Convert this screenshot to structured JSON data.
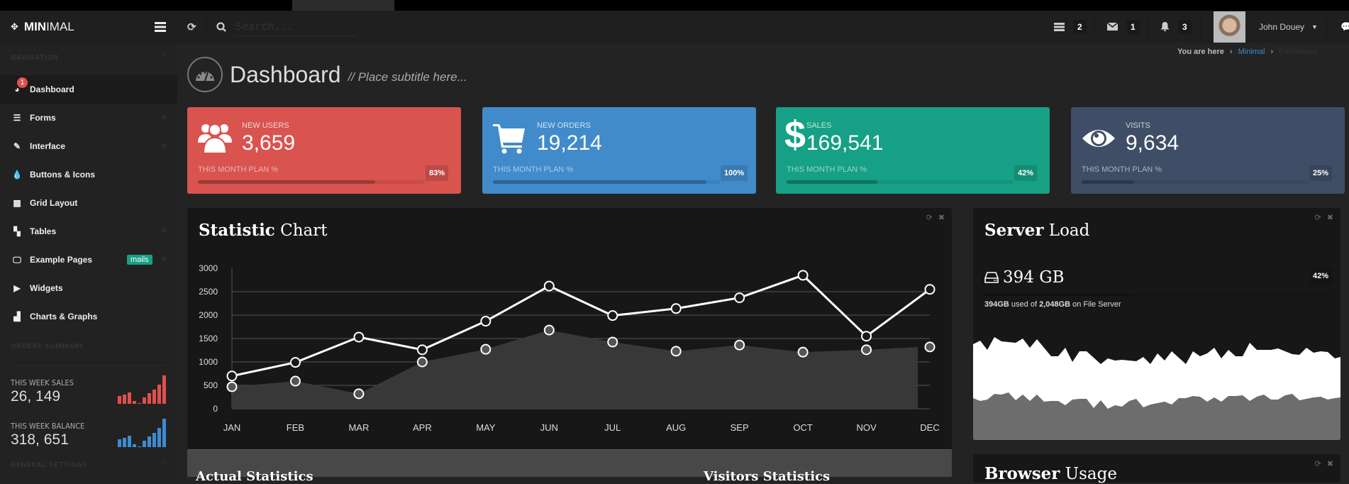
{
  "brand": {
    "bold": "MIN",
    "rest": "IMAL"
  },
  "header": {
    "search_placeholder": "Search...",
    "notifications": [
      {
        "icon": "tasks-icon",
        "count": "2"
      },
      {
        "icon": "envelope-icon",
        "count": "1"
      },
      {
        "icon": "bell-icon",
        "count": "3"
      }
    ],
    "user_name": "John Douey"
  },
  "breadcrumb": {
    "prefix": "You are here",
    "items": [
      "Minimal",
      "Dashboard"
    ]
  },
  "page": {
    "title": "Dashboard",
    "subtitle": "// Place subtitle here..."
  },
  "sidebar": {
    "navigation_title": "NAVIGATION",
    "items": [
      {
        "label": "Dashboard",
        "icon": "dashboard-icon",
        "badge": "1",
        "active": true
      },
      {
        "label": "Forms",
        "icon": "list-icon",
        "expandable": true
      },
      {
        "label": "Interface",
        "icon": "pencil-icon",
        "expandable": true
      },
      {
        "label": "Buttons & Icons",
        "icon": "tint-icon"
      },
      {
        "label": "Grid Layout",
        "icon": "grid-icon"
      },
      {
        "label": "Tables",
        "icon": "table-icon",
        "expandable": true
      },
      {
        "label": "Example Pages",
        "icon": "desktop-icon",
        "tag": "mails",
        "expandable": true
      },
      {
        "label": "Widgets",
        "icon": "play-circle-icon"
      },
      {
        "label": "Charts & Graphs",
        "icon": "bar-chart-icon"
      }
    ],
    "orders_title": "ORDERS SUMMARY",
    "week_sales": {
      "label": "THIS WEEK SALES",
      "value": "26, 149",
      "color": "#e0504d",
      "bars": [
        4,
        5,
        6,
        1.5,
        0.5,
        3.5,
        5.5,
        7.5,
        10,
        15
      ]
    },
    "week_balance": {
      "label": "THIS WEEK BALANCE",
      "value": "318, 651",
      "color": "#3d8bd2",
      "bars": [
        4,
        5,
        6,
        1.5,
        0.5,
        3.5,
        5.5,
        7.5,
        10,
        15
      ]
    },
    "settings_title": "GENERAL SETTINGS"
  },
  "cards": [
    {
      "label": "NEW USERS",
      "value": "3,659",
      "plan_label": "THIS MONTH PLAN %",
      "percent": "83%",
      "progress": 0.78,
      "color": "#d9534f",
      "icon": "users-icon"
    },
    {
      "label": "NEW ORDERS",
      "value": "19,214",
      "plan_label": "THIS MONTH PLAN %",
      "percent": "100%",
      "progress": 0.94,
      "color": "#418bca",
      "icon": "shopping-cart-icon"
    },
    {
      "label": "SALES",
      "value": "169,541",
      "plan_label": "THIS MONTH PLAN %",
      "percent": "42%",
      "progress": 0.4,
      "color": "#16a085",
      "icon": "dollar-icon"
    },
    {
      "label": "VISITS",
      "value": "9,634",
      "plan_label": "THIS MONTH PLAN %",
      "percent": "25%",
      "progress": 0.23,
      "color": "#3f4e66",
      "icon": "eye-icon"
    }
  ],
  "statistic_panel": {
    "title_bold": "Statistic",
    "title_rest": "Chart"
  },
  "chart_data": {
    "type": "line",
    "title": "Statistic Chart",
    "categories": [
      "JAN",
      "FEB",
      "MAR",
      "APR",
      "MAY",
      "JUN",
      "JUL",
      "AUG",
      "SEP",
      "OCT",
      "NOV",
      "DEC"
    ],
    "series": [
      {
        "name": "line",
        "style": "line",
        "values": [
          700,
          990,
          1530,
          1260,
          1870,
          2620,
          1990,
          2140,
          2370,
          2850,
          1550,
          2550
        ]
      },
      {
        "name": "area",
        "style": "area",
        "values": [
          470,
          590,
          320,
          1000,
          1270,
          1680,
          1425,
          1230,
          1360,
          1210,
          1260,
          1320
        ]
      }
    ],
    "yticks": [
      0,
      500,
      1000,
      1500,
      2000,
      2500,
      3000
    ],
    "ylim": [
      0,
      3000
    ],
    "grid": true,
    "xlabel": "",
    "ylabel": ""
  },
  "server_panel": {
    "title_bold": "Server",
    "title_rest": "Load",
    "value": "394 GB",
    "percent": "42%",
    "progress": 0.42,
    "desc_used": "394GB",
    "desc_mid": " used of ",
    "desc_total": "2,048GB",
    "desc_end": " on File Server"
  },
  "lower_panel": {
    "actual": "Actual Statistics",
    "visitors": "Visitors Statistics"
  },
  "browser_panel": {
    "title_bold": "Browser",
    "title_rest": "Usage"
  }
}
